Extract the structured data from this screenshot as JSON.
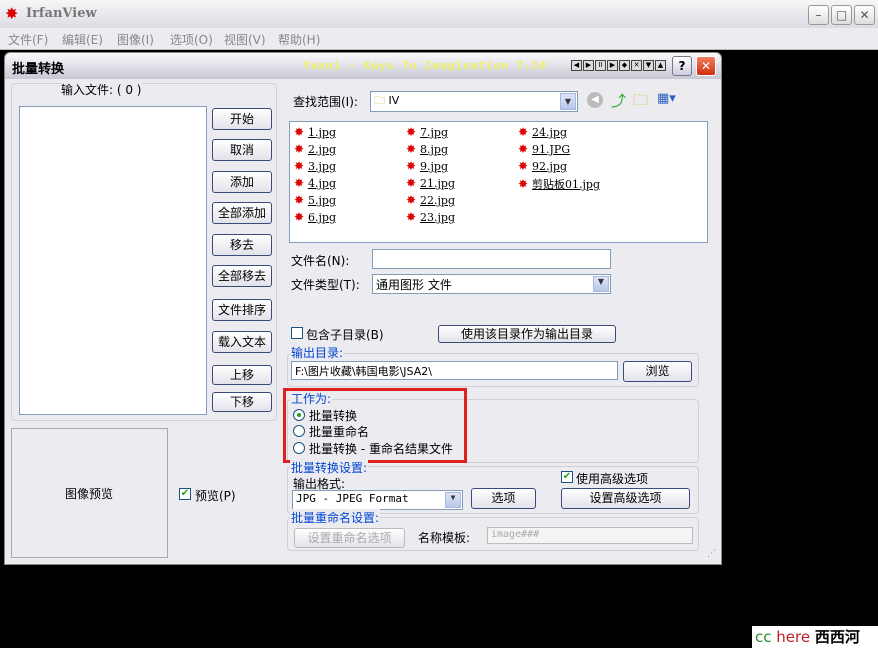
{
  "app": {
    "title": "IrfanView",
    "menu": [
      "文件(F)",
      "编辑(E)",
      "图像(I)",
      "选项(O)",
      "视图(V)",
      "帮助(H)"
    ]
  },
  "dialog": {
    "title": "批量转换",
    "now_playing": "Yanni - Keys To Imagination  7:24",
    "input_files_label": "输入文件: ( 0 )",
    "buttons": [
      "开始",
      "取消",
      "添加",
      "全部添加",
      "移去",
      "全部移去",
      "文件排序",
      "载入文本",
      "上移",
      "下移"
    ],
    "preview_label": "图像预览",
    "preview_checkbox": "预览(P)",
    "lookin_label": "查找范围(I):",
    "lookin_value": "IV",
    "files": [
      [
        "1.jpg",
        "2.jpg",
        "3.jpg",
        "4.jpg",
        "5.jpg",
        "6.jpg"
      ],
      [
        "7.jpg",
        "8.jpg",
        "9.jpg",
        "21.jpg",
        "22.jpg",
        "23.jpg"
      ],
      [
        "24.jpg",
        "91.JPG",
        "92.jpg",
        "剪贴板01.jpg"
      ]
    ],
    "filename_label": "文件名(N):",
    "filename_value": "",
    "filetype_label": "文件类型(T):",
    "filetype_value": "通用图形 文件",
    "subdir_checkbox": "包含子目录(B)",
    "use_dir_button": "使用该目录作为输出目录",
    "output_dir": {
      "label": "输出目录:",
      "value": "F:\\图片收藏\\韩国电影\\JSA2\\",
      "browse": "浏览"
    },
    "work_as": {
      "label": "工作为:",
      "options": [
        "批量转换",
        "批量重命名",
        "批量转换 - 重命名结果文件"
      ],
      "selected": 0
    },
    "convert_settings": {
      "label": "批量转换设置:",
      "format_label": "输出格式:",
      "format_value": "JPG - JPEG Format",
      "options_button": "选项",
      "advanced_checkbox": "使用高级选项",
      "advanced_button": "设置高级选项"
    },
    "rename_settings": {
      "label": "批量重命名设置:",
      "rename_button": "设置重命名选项",
      "template_label": "名称模板:",
      "template_value": "image###"
    }
  },
  "watermark": {
    "cc": "cc",
    "here": "here",
    "site": "西西河"
  },
  "colors": {
    "highlight": "#e02020",
    "group_label": "#0046d5"
  }
}
